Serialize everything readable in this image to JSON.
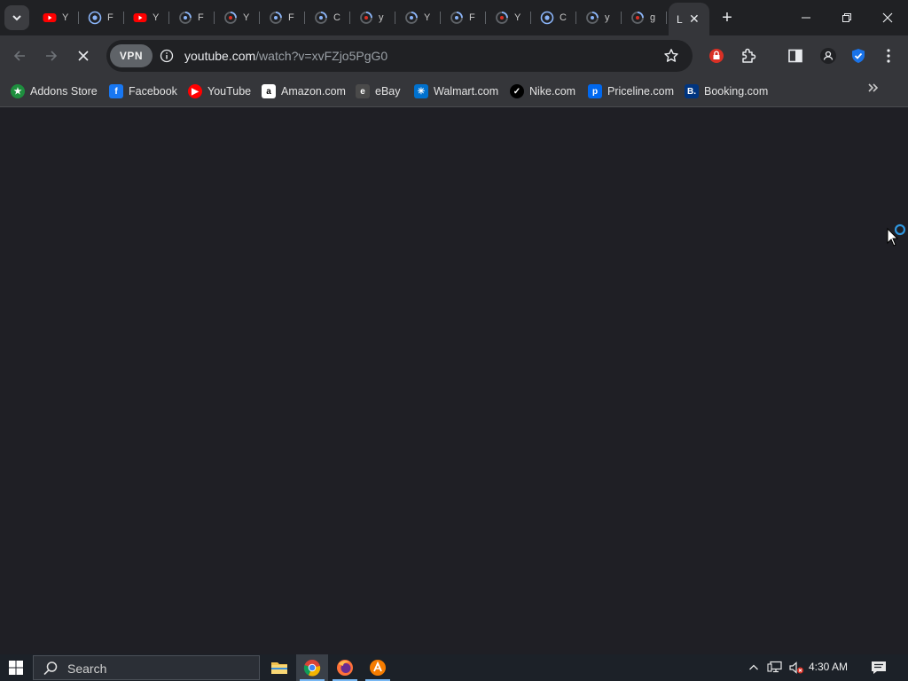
{
  "browser": {
    "tabs": [
      {
        "icon": "youtube-icon",
        "title": "Y"
      },
      {
        "icon": "chrome-icon",
        "title": "F"
      },
      {
        "icon": "youtube-icon",
        "title": "Y"
      },
      {
        "icon": "loading-icon",
        "title": "F"
      },
      {
        "icon": "loading-icon",
        "title": "Y"
      },
      {
        "icon": "loading-icon",
        "title": "F"
      },
      {
        "icon": "loading-icon",
        "title": "C"
      },
      {
        "icon": "loading-icon",
        "title": "y"
      },
      {
        "icon": "loading-icon",
        "title": "Y"
      },
      {
        "icon": "loading-icon",
        "title": "F"
      },
      {
        "icon": "loading-icon",
        "title": "Y"
      },
      {
        "icon": "chrome-icon",
        "title": "C"
      },
      {
        "icon": "loading-icon",
        "title": "y"
      },
      {
        "icon": "loading-icon",
        "title": "g"
      }
    ],
    "active_tab": {
      "title": "L"
    },
    "omnibox": {
      "vpn_label": "VPN",
      "url_host": "youtube.com",
      "url_path": "/watch?v=xvFZjo5PgG0"
    },
    "bookmarks": [
      {
        "label": "Addons Store",
        "icon": "addons-store-icon",
        "color": "#1e8e3e",
        "glyph": "★"
      },
      {
        "label": "Facebook",
        "icon": "facebook-icon",
        "color": "#1877f2",
        "glyph": "f"
      },
      {
        "label": "YouTube",
        "icon": "youtube-icon",
        "color": "#ff0000",
        "glyph": "▶"
      },
      {
        "label": "Amazon.com",
        "icon": "amazon-icon",
        "color": "#ffffff",
        "glyph": "a"
      },
      {
        "label": "eBay",
        "icon": "ebay-icon",
        "color": "#4a4a4a",
        "glyph": "e"
      },
      {
        "label": "Walmart.com",
        "icon": "walmart-icon",
        "color": "#0071ce",
        "glyph": "✳"
      },
      {
        "label": "Nike.com",
        "icon": "nike-icon",
        "color": "#000000",
        "glyph": "✓"
      },
      {
        "label": "Priceline.com",
        "icon": "priceline-icon",
        "color": "#0068ef",
        "glyph": "p"
      },
      {
        "label": "Booking.com",
        "icon": "booking-icon",
        "color": "#003580",
        "glyph": "B."
      }
    ]
  },
  "taskbar": {
    "search_placeholder": "Search",
    "time": "4:30 AM"
  },
  "colors": {
    "page_bg": "#1f1f25",
    "toolbar": "#35363a",
    "tabstrip": "#202124",
    "taskbar": "#1c2128"
  }
}
